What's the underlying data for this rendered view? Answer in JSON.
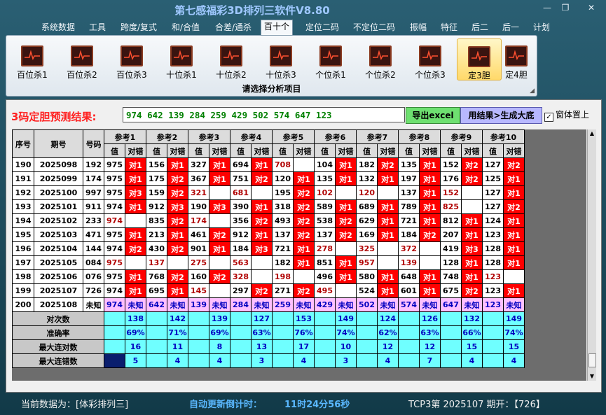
{
  "window": {
    "title": "第七感福彩3D排列三软件V8.80",
    "minimize": "—",
    "restore": "❐",
    "close": "✕"
  },
  "menu": [
    "系统数据",
    "工具",
    "跨度/复式",
    "和/合值",
    "合差/通杀",
    "百十个",
    "定位二码",
    "不定位二码",
    "振幅",
    "特征",
    "后二",
    "后一",
    "计划"
  ],
  "menu_active": "百十个",
  "toolbar": {
    "buttons": [
      "百位杀1",
      "百位杀2",
      "百位杀3",
      "十位杀1",
      "十位杀2",
      "十位杀3",
      "个位杀1",
      "个位杀2",
      "个位杀3",
      "定3胆",
      "定4胆"
    ],
    "active": "定3胆",
    "caption": "请选择分析项目",
    "icon": "chart-icon"
  },
  "prediction": {
    "label": "3码定胆预测结果:",
    "value": "974 642 139 284 259 429 502 574 647 123",
    "excel_button": "导出excel",
    "generate_button": "用结果>生成大底",
    "ontop_label": "窗体置上",
    "ontop_checked": "✓"
  },
  "table": {
    "headers": [
      "序号",
      "期号",
      "号码"
    ],
    "group_headers": [
      "参考1",
      "参考2",
      "参考3",
      "参考4",
      "参考5",
      "参考6",
      "参考7",
      "参考8",
      "参考9",
      "参考10"
    ],
    "sub_headers": [
      "值",
      "对错"
    ],
    "rows": [
      {
        "seq": "190",
        "period": "2025098",
        "num": "192",
        "cells": [
          [
            "975",
            "对1"
          ],
          [
            "156",
            "对1"
          ],
          [
            "327",
            "对1"
          ],
          [
            "694",
            "对1"
          ],
          [
            "708",
            ""
          ],
          [
            "104",
            "对1"
          ],
          [
            "182",
            "对2"
          ],
          [
            "135",
            "对1"
          ],
          [
            "152",
            "对2"
          ],
          [
            "127",
            "对2"
          ]
        ]
      },
      {
        "seq": "191",
        "period": "2025099",
        "num": "174",
        "cells": [
          [
            "975",
            "对1"
          ],
          [
            "175",
            "对2"
          ],
          [
            "367",
            "对1"
          ],
          [
            "751",
            "对2"
          ],
          [
            "120",
            "对1"
          ],
          [
            "135",
            "对1"
          ],
          [
            "132",
            "对1"
          ],
          [
            "197",
            "对1"
          ],
          [
            "176",
            "对2"
          ],
          [
            "125",
            "对1"
          ]
        ]
      },
      {
        "seq": "192",
        "period": "2025100",
        "num": "997",
        "cells": [
          [
            "975",
            "对3"
          ],
          [
            "159",
            "对2"
          ],
          [
            "321",
            ""
          ],
          [
            "681",
            ""
          ],
          [
            "195",
            "对2"
          ],
          [
            "102",
            ""
          ],
          [
            "120",
            ""
          ],
          [
            "137",
            "对1"
          ],
          [
            "152",
            ""
          ],
          [
            "127",
            "对1"
          ]
        ]
      },
      {
        "seq": "193",
        "period": "2025101",
        "num": "911",
        "cells": [
          [
            "974",
            "对1"
          ],
          [
            "912",
            "对3"
          ],
          [
            "190",
            "对3"
          ],
          [
            "390",
            "对1"
          ],
          [
            "318",
            "对2"
          ],
          [
            "589",
            "对1"
          ],
          [
            "689",
            "对1"
          ],
          [
            "789",
            "对1"
          ],
          [
            "825",
            ""
          ],
          [
            "127",
            "对2"
          ]
        ]
      },
      {
        "seq": "194",
        "period": "2025102",
        "num": "233",
        "cells": [
          [
            "974",
            ""
          ],
          [
            "835",
            "对2"
          ],
          [
            "174",
            ""
          ],
          [
            "356",
            "对2"
          ],
          [
            "493",
            "对2"
          ],
          [
            "538",
            "对2"
          ],
          [
            "629",
            "对1"
          ],
          [
            "721",
            "对1"
          ],
          [
            "812",
            "对1"
          ],
          [
            "124",
            "对1"
          ]
        ]
      },
      {
        "seq": "195",
        "period": "2025103",
        "num": "471",
        "cells": [
          [
            "975",
            "对1"
          ],
          [
            "213",
            "对1"
          ],
          [
            "461",
            "对2"
          ],
          [
            "912",
            "对1"
          ],
          [
            "137",
            "对2"
          ],
          [
            "137",
            "对2"
          ],
          [
            "169",
            "对1"
          ],
          [
            "184",
            "对2"
          ],
          [
            "207",
            "对1"
          ],
          [
            "123",
            "对1"
          ]
        ]
      },
      {
        "seq": "196",
        "period": "2025104",
        "num": "144",
        "cells": [
          [
            "974",
            "对2"
          ],
          [
            "430",
            "对2"
          ],
          [
            "901",
            "对1"
          ],
          [
            "184",
            "对3"
          ],
          [
            "721",
            "对1"
          ],
          [
            "278",
            ""
          ],
          [
            "325",
            ""
          ],
          [
            "372",
            ""
          ],
          [
            "419",
            "对3"
          ],
          [
            "128",
            "对1"
          ]
        ]
      },
      {
        "seq": "197",
        "period": "2025105",
        "num": "084",
        "cells": [
          [
            "975",
            ""
          ],
          [
            "137",
            ""
          ],
          [
            "275",
            ""
          ],
          [
            "563",
            ""
          ],
          [
            "182",
            "对1"
          ],
          [
            "851",
            "对1"
          ],
          [
            "957",
            ""
          ],
          [
            "139",
            ""
          ],
          [
            "128",
            "对1"
          ],
          [
            "128",
            "对1"
          ]
        ]
      },
      {
        "seq": "198",
        "period": "2025106",
        "num": "076",
        "cells": [
          [
            "975",
            "对1"
          ],
          [
            "768",
            "对2"
          ],
          [
            "160",
            "对2"
          ],
          [
            "328",
            ""
          ],
          [
            "198",
            ""
          ],
          [
            "496",
            "对1"
          ],
          [
            "580",
            "对1"
          ],
          [
            "648",
            "对1"
          ],
          [
            "748",
            "对1"
          ],
          [
            "123",
            ""
          ]
        ]
      },
      {
        "seq": "199",
        "period": "2025107",
        "num": "726",
        "cells": [
          [
            "974",
            "对1"
          ],
          [
            "695",
            "对1"
          ],
          [
            "145",
            ""
          ],
          [
            "297",
            "对2"
          ],
          [
            "271",
            "对2"
          ],
          [
            "495",
            ""
          ],
          [
            "524",
            "对1"
          ],
          [
            "601",
            "对1"
          ],
          [
            "675",
            "对2"
          ],
          [
            "123",
            "对1"
          ]
        ]
      }
    ],
    "pending_row": {
      "seq": "200",
      "period": "2025108",
      "num": "未知",
      "vals": [
        "974",
        "642",
        "139",
        "284",
        "259",
        "429",
        "502",
        "574",
        "647",
        "123"
      ],
      "status": "未知"
    },
    "stats": [
      {
        "label": "对次数",
        "values": [
          "138",
          "142",
          "139",
          "127",
          "153",
          "149",
          "124",
          "126",
          "132",
          "149"
        ]
      },
      {
        "label": "准确率",
        "values": [
          "69%",
          "71%",
          "69%",
          "63%",
          "76%",
          "74%",
          "62%",
          "63%",
          "66%",
          "74%"
        ]
      },
      {
        "label": "最大连对数",
        "values": [
          "16",
          "11",
          "8",
          "13",
          "17",
          "10",
          "12",
          "12",
          "15",
          "15"
        ]
      },
      {
        "label": "最大连错数",
        "values": [
          "5",
          "4",
          "4",
          "3",
          "4",
          "3",
          "4",
          "7",
          "4",
          "4"
        ]
      }
    ]
  },
  "status": {
    "current_data": "当前数据为：[体彩排列三]",
    "countdown_label": "自动更新倒计时：",
    "countdown": "11时24分56秒",
    "latest": "TCP3第 2025107 期开：【726】"
  },
  "colors": {
    "hit": "#ff0000",
    "miss_text": "#b00000",
    "pending": "#ffc0ff",
    "stat": "#6fffff",
    "predict": "#008000"
  }
}
